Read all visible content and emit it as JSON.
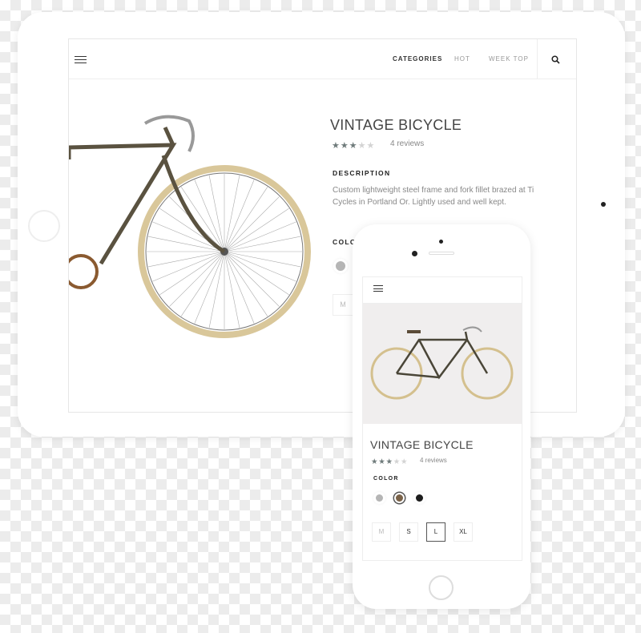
{
  "tablet": {
    "nav": {
      "menu_icon": "hamburger-icon",
      "items": [
        "CATEGORIES",
        "HOT",
        "WEEK TOP"
      ],
      "active": "CATEGORIES",
      "search_icon": "search-icon"
    },
    "product": {
      "title": "VINTAGE BICYCLE",
      "rating": 3,
      "rating_max": 5,
      "reviews": "4 reviews",
      "description_heading": "DESCRIPTION",
      "description": "Custom lightweight steel frame and fork fillet brazed at Ti Cycles in Portland Or. Lightly used and well kept.",
      "color_heading": "COLOR",
      "colors": [
        "#b5b5b5"
      ],
      "sizes": [
        "M"
      ]
    }
  },
  "phone": {
    "nav": {
      "menu_icon": "hamburger-icon"
    },
    "product": {
      "title": "VINTAGE BICYCLE",
      "rating": 3,
      "rating_max": 5,
      "reviews": "4 reviews",
      "color_heading": "COLOR",
      "colors": [
        "#b5b5b5",
        "#7a6248",
        "#1c1c1c"
      ],
      "selected_color": "#7a6248",
      "sizes": [
        "M",
        "S",
        "L",
        "XL"
      ],
      "selected_size": "L",
      "disabled_sizes": [
        "M"
      ]
    }
  }
}
